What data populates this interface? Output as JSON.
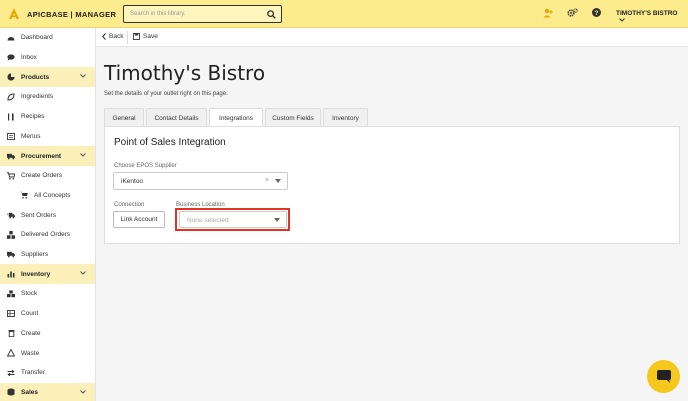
{
  "app": {
    "brand": "APICBASE | MANAGER",
    "user_menu": "TIMOTHY'S BISTRO",
    "accent": "#fcec8e"
  },
  "search": {
    "placeholder": "Search in this library."
  },
  "sidebar": {
    "items": [
      {
        "label": "Dashboard",
        "icon": "dashboard-icon"
      },
      {
        "label": "Inbox",
        "icon": "chat-bubble-icon"
      },
      {
        "label": "Products",
        "icon": "pie-chart-icon",
        "section": true
      },
      {
        "label": "Ingredients",
        "icon": "leaf-icon"
      },
      {
        "label": "Recipes",
        "icon": "utensils-icon"
      },
      {
        "label": "Menus",
        "icon": "menu-book-icon"
      },
      {
        "label": "Procurement",
        "icon": "truck-icon",
        "section": true
      },
      {
        "label": "Create Orders",
        "icon": "cart-icon"
      },
      {
        "label": "All Concepts",
        "icon": "cart-icon",
        "sub": true
      },
      {
        "label": "Sent Orders",
        "icon": "sent-truck-icon"
      },
      {
        "label": "Delivered Orders",
        "icon": "boxes-icon"
      },
      {
        "label": "Suppliers",
        "icon": "supplier-truck-icon"
      },
      {
        "label": "Inventory",
        "icon": "bar-chart-icon",
        "section": true
      },
      {
        "label": "Stock",
        "icon": "cubes-icon"
      },
      {
        "label": "Count",
        "icon": "count-icon"
      },
      {
        "label": "Create",
        "icon": "trash-icon"
      },
      {
        "label": "Waste",
        "icon": "recycle-icon"
      },
      {
        "label": "Transfer",
        "icon": "transfer-icon"
      },
      {
        "label": "Sales",
        "icon": "coins-icon",
        "section": true
      }
    ]
  },
  "toolbar": {
    "back_label": "Back",
    "save_label": "Save"
  },
  "page": {
    "title": "Timothy's Bistro",
    "subtitle": "Set the details of your outlet right on this page."
  },
  "tabs": [
    {
      "label": "General"
    },
    {
      "label": "Contact Details"
    },
    {
      "label": "Integrations",
      "active": true
    },
    {
      "label": "Custom Fields"
    },
    {
      "label": "Inventory"
    }
  ],
  "integration": {
    "title": "Point of Sales Integration",
    "supplier_label": "Choose EPOS Supplier",
    "supplier_value": "iKentoo",
    "clear_glyph": "×",
    "connection_label": "Connection",
    "link_button": "Link Account",
    "location_label": "Business Location",
    "location_placeholder": "None selected"
  }
}
